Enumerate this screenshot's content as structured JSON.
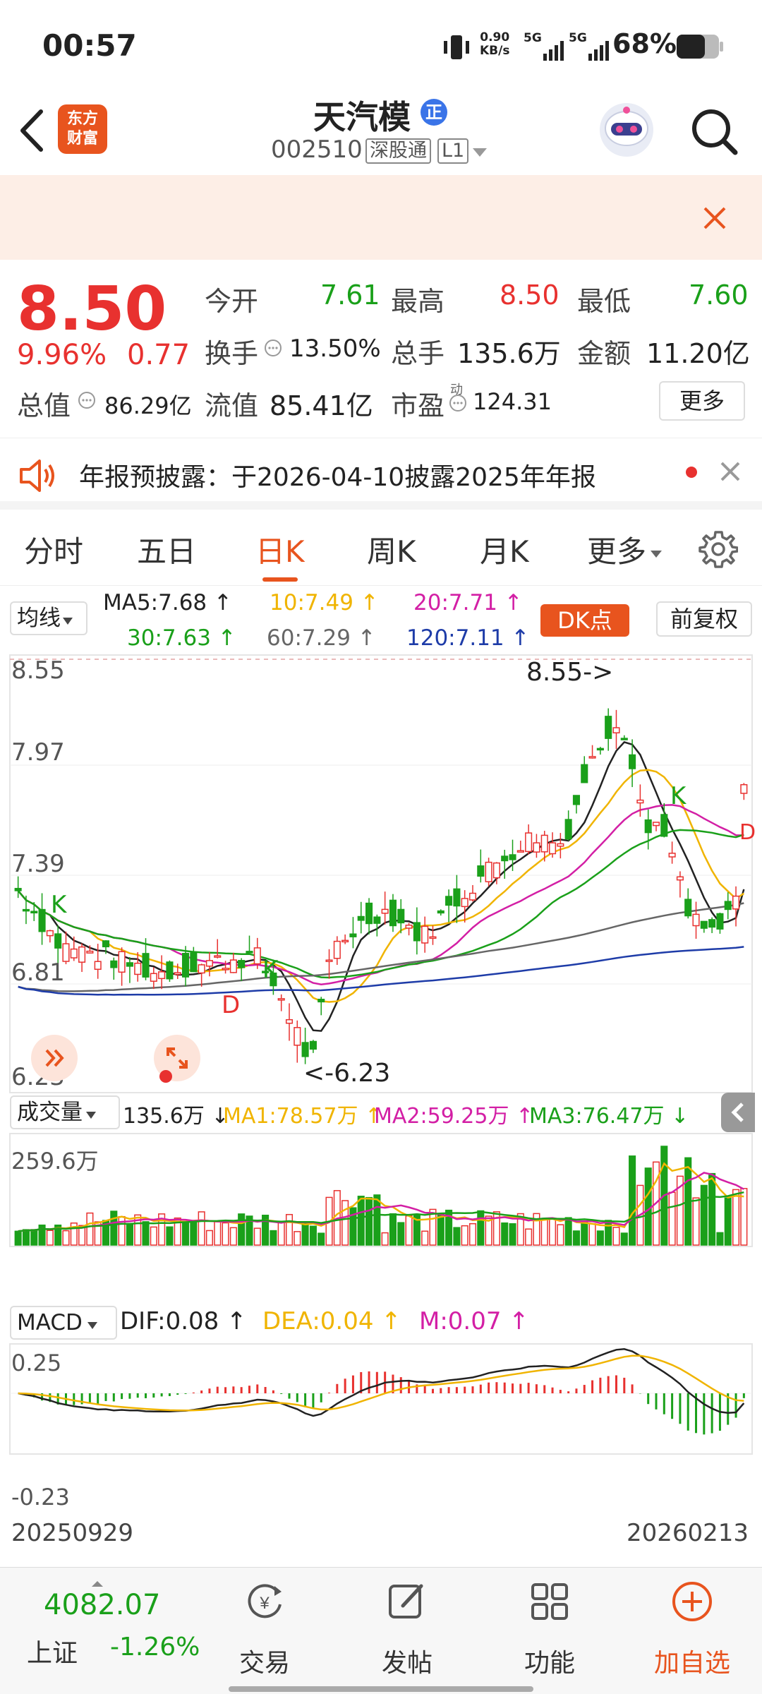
{
  "status_bar": {
    "time": "00:57",
    "net_speed_top": "0.90",
    "net_speed_bottom": "KB/s",
    "sig1": "5G",
    "sig2": "5G",
    "battery": "68%"
  },
  "header": {
    "logo_line1": "东方",
    "logo_line2": "财富",
    "stock_name": "天汽模",
    "badge": "正",
    "stock_code": "002510",
    "tag1": "深股通",
    "tag2": "L1"
  },
  "quote": {
    "price": "8.50",
    "pct": "9.96%",
    "change": "0.77",
    "open_label": "今开",
    "open": "7.61",
    "high_label": "最高",
    "high": "8.50",
    "low_label": "最低",
    "low": "7.60",
    "turnover_label": "换手",
    "turnover": "13.50%",
    "volume_label": "总手",
    "volume": "135.6万",
    "amount_label": "金额",
    "amount": "11.20亿",
    "mktcap_label": "总值",
    "mktcap": "86.29亿",
    "float_label": "流值",
    "float_cap": "85.41亿",
    "pe_label": "市盈",
    "pe_sup": "动",
    "pe": "124.31",
    "more_button": "更多"
  },
  "notice": {
    "text": "年报预披露：于2026-04-10披露2025年年报"
  },
  "tabs": [
    "分时",
    "五日",
    "日K",
    "周K",
    "月K",
    "更多"
  ],
  "ma_legend": {
    "selector": "均线",
    "ma5": "MA5:7.68 ↑",
    "ma10": "10:7.49 ↑",
    "ma20": "20:7.71 ↑",
    "ma30": "30:7.63 ↑",
    "ma60": "60:7.29 ↑",
    "ma120": "120:7.11 ↑",
    "dk_button": "DK点",
    "adjust_button": "前复权"
  },
  "kline": {
    "y_top": "8.55",
    "y_2": "7.97",
    "y_3": "7.39",
    "y_4": "6.81",
    "y_bottom": "6.23",
    "high_annot": "8.55->",
    "low_annot": "<-6.23",
    "k1": "K",
    "k2": "K",
    "k3": "K",
    "d1": "D",
    "d2": "D"
  },
  "volume_legend": {
    "selector": "成交量",
    "vol": "135.6万 ↓",
    "ma1": "MA1:78.57万 ↑",
    "ma2": "MA2:59.25万 ↑",
    "ma3": "MA3:76.47万 ↓",
    "y_top": "259.6万"
  },
  "macd_legend": {
    "selector": "MACD",
    "dif": "DIF:0.08 ↑",
    "dea": "DEA:0.04 ↑",
    "m": "M:0.07 ↑",
    "y_top": "0.25",
    "y_bottom": "-0.23"
  },
  "dates": {
    "start": "20250929",
    "end": "20260213"
  },
  "bottom_nav": {
    "index_value": "4082.07",
    "index_name": "上证",
    "index_pct": "-1.26%",
    "trade": "交易",
    "post": "发帖",
    "func": "功能",
    "watch": "加自选"
  },
  "colors": {
    "up": "#e8312f",
    "down": "#1aa01a",
    "accent": "#e8541e",
    "ma5": "#222222",
    "ma10": "#f0b400",
    "ma20": "#d31fa5",
    "ma30": "#1aa01a",
    "ma60": "#666666",
    "ma120": "#1e3ca8"
  }
}
